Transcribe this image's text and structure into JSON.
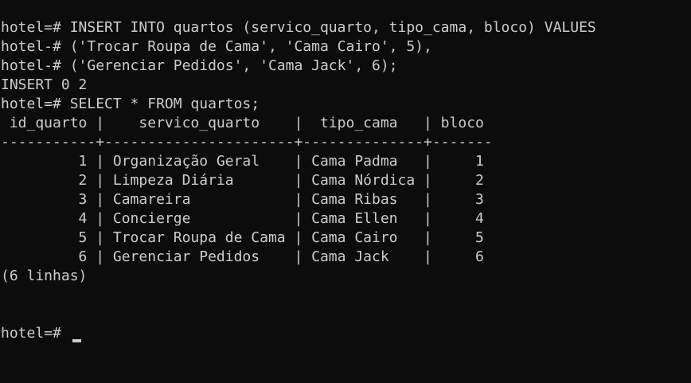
{
  "terminal": {
    "lines": [
      "hotel=# INSERT INTO quartos (servico_quarto, tipo_cama, bloco) VALUES",
      "hotel-# ('Trocar Roupa de Cama', 'Cama Cairo', 5),",
      "hotel-# ('Gerenciar Pedidos', 'Cama Jack', 6);",
      "INSERT 0 2",
      "hotel=# SELECT * FROM quartos;",
      " id_quarto |    servico_quarto    |  tipo_cama   | bloco",
      "-----------+----------------------+--------------+-------",
      "         1 | Organização Geral    | Cama Padma   |     1",
      "         2 | Limpeza Diária       | Cama Nórdica |     2",
      "         3 | Camareira            | Cama Ribas   |     3",
      "         4 | Concierge            | Cama Ellen   |     4",
      "         5 | Trocar Roupa de Cama | Cama Cairo   |     5",
      "         6 | Gerenciar Pedidos    | Cama Jack    |     6",
      "(6 linhas)",
      "",
      ""
    ],
    "prompt": "hotel=# "
  }
}
